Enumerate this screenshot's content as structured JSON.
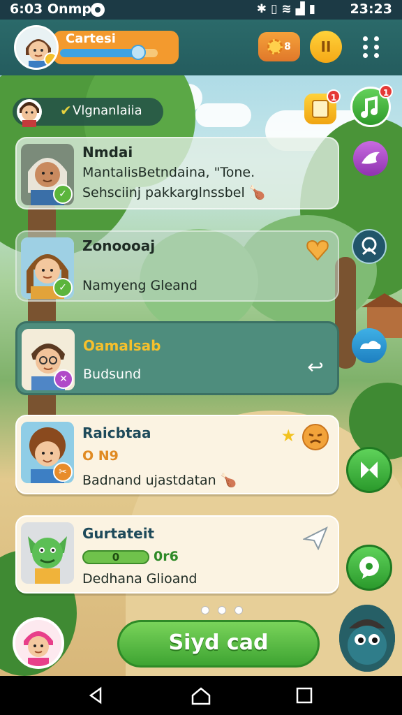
{
  "status_bar": {
    "time": "6:03",
    "carrier": "Onmp",
    "clock": "23:23",
    "icons": [
      "bluetooth-icon",
      "vibrate-icon",
      "wifi-icon",
      "signal-icon",
      "battery-icon"
    ]
  },
  "header": {
    "player_name": "Cartesi",
    "xp_progress": 0.8,
    "coins": "8",
    "pause_symbol": "II"
  },
  "location": {
    "name": "Vlgnanlaiia",
    "check": "✔"
  },
  "cards": [
    {
      "title": "Nmdai",
      "line1": "MantalisBetndaina, \"Tone.",
      "line2": "Sehsciinj pakkarglnssbel"
    },
    {
      "title": "Zonoooaj",
      "line1": "Namyeng Gleand"
    },
    {
      "title": "Oamalsab",
      "line1": "Budsund"
    },
    {
      "title": "Raicbtaa",
      "subtitle": "O N9",
      "line1": "Badnand ujastdatan"
    },
    {
      "title": "Gurtateit",
      "progress_label": "0",
      "progress_value": "0r6",
      "line1": "Dedhana Glioand"
    }
  ],
  "side_buttons": [
    {
      "icon": "music-note-icon",
      "badge": "1"
    },
    {
      "icon": "bird-icon"
    },
    {
      "icon": "quest-icon"
    },
    {
      "icon": "cloud-icon"
    },
    {
      "icon": "skip-icon"
    },
    {
      "icon": "chat-icon"
    }
  ],
  "notes_badge": "1",
  "main_button": {
    "label": "Siyd cad"
  },
  "pager": {
    "count": 3,
    "active": 1
  },
  "colors": {
    "accent_green": "#3ea432",
    "header_teal": "#245c5e",
    "coin_orange": "#e0782a",
    "pause_yellow": "#f5a816"
  }
}
